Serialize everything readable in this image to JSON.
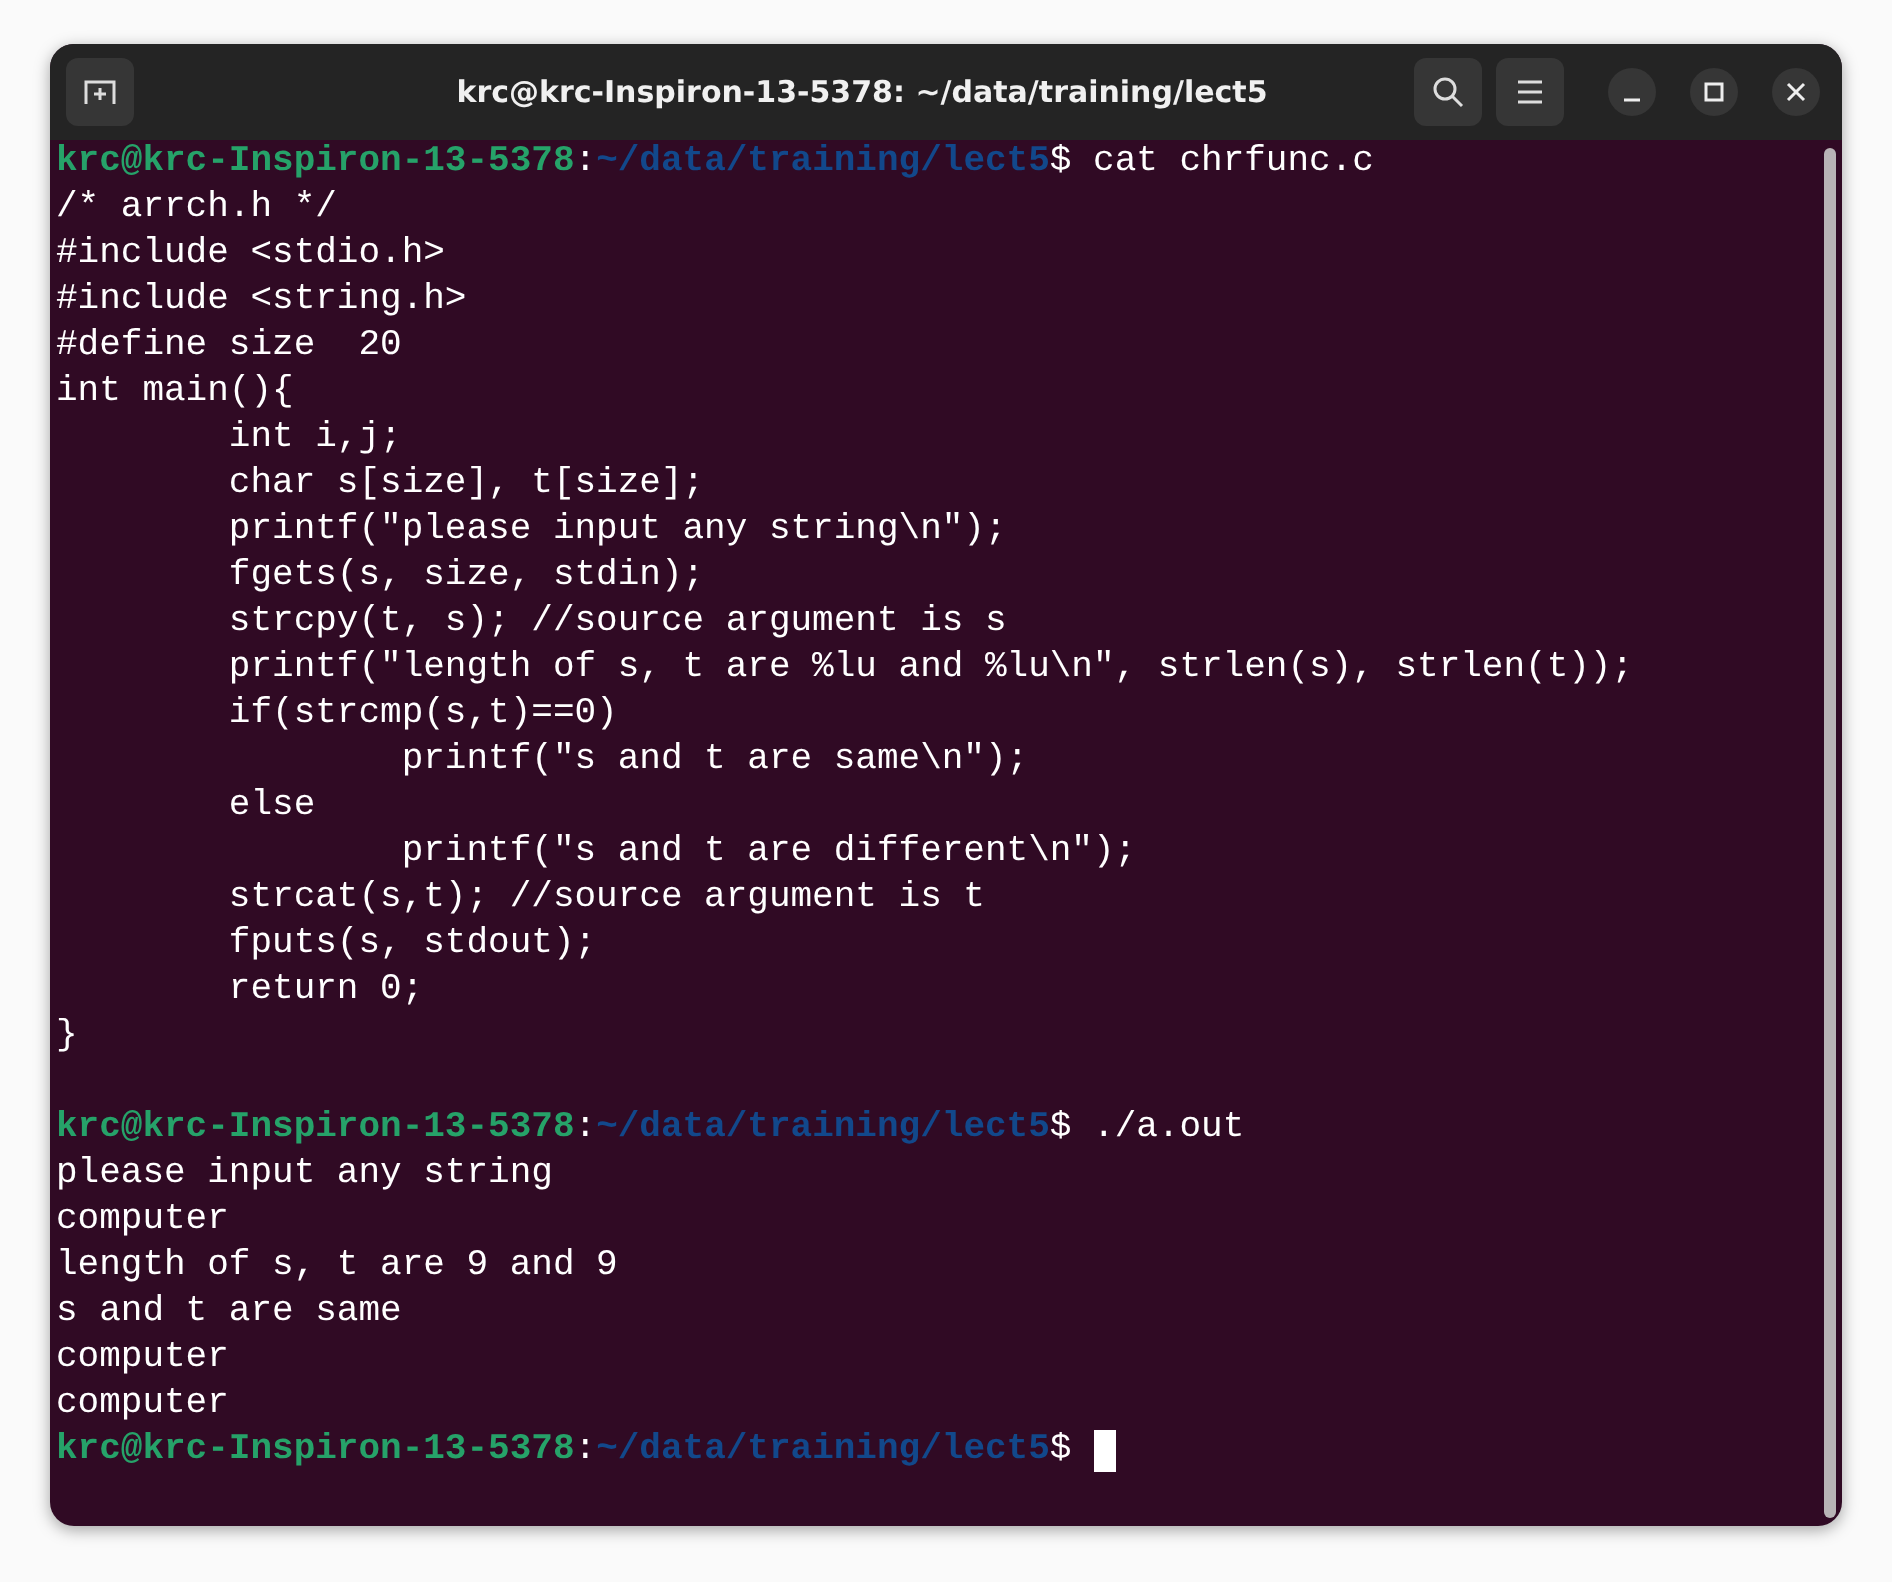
{
  "window": {
    "title": "krc@krc-Inspiron-13-5378: ~/data/training/lect5"
  },
  "terminal": {
    "lines": [
      {
        "kind": "prompt",
        "user_host": "krc@krc-Inspiron-13-5378",
        "colon": ":",
        "path": "~/data/training/lect5",
        "dollar": "$",
        "command": " cat chrfunc.c",
        "cursor": false
      },
      {
        "kind": "output",
        "text": "/* arrch.h */"
      },
      {
        "kind": "output",
        "text": "#include <stdio.h>"
      },
      {
        "kind": "output",
        "text": "#include <string.h>"
      },
      {
        "kind": "output",
        "text": "#define size  20"
      },
      {
        "kind": "output",
        "text": "int main(){"
      },
      {
        "kind": "output",
        "text": "        int i,j;"
      },
      {
        "kind": "output",
        "text": "        char s[size], t[size];"
      },
      {
        "kind": "output",
        "text": "        printf(\"please input any string\\n\");"
      },
      {
        "kind": "output",
        "text": "        fgets(s, size, stdin);"
      },
      {
        "kind": "output",
        "text": "        strcpy(t, s); //source argument is s"
      },
      {
        "kind": "output",
        "text": "        printf(\"length of s, t are %lu and %lu\\n\", strlen(s), strlen(t));"
      },
      {
        "kind": "output",
        "text": "        if(strcmp(s,t)==0)"
      },
      {
        "kind": "output",
        "text": "                printf(\"s and t are same\\n\");"
      },
      {
        "kind": "output",
        "text": "        else"
      },
      {
        "kind": "output",
        "text": "                printf(\"s and t are different\\n\");"
      },
      {
        "kind": "output",
        "text": "        strcat(s,t); //source argument is t"
      },
      {
        "kind": "output",
        "text": "        fputs(s, stdout);"
      },
      {
        "kind": "output",
        "text": "        return 0;"
      },
      {
        "kind": "output",
        "text": "}"
      },
      {
        "kind": "blank"
      },
      {
        "kind": "prompt",
        "user_host": "krc@krc-Inspiron-13-5378",
        "colon": ":",
        "path": "~/data/training/lect5",
        "dollar": "$",
        "command": " ./a.out",
        "cursor": false
      },
      {
        "kind": "output",
        "text": "please input any string"
      },
      {
        "kind": "output",
        "text": "computer"
      },
      {
        "kind": "output",
        "text": "length of s, t are 9 and 9"
      },
      {
        "kind": "output",
        "text": "s and t are same"
      },
      {
        "kind": "output",
        "text": "computer"
      },
      {
        "kind": "output",
        "text": "computer"
      },
      {
        "kind": "prompt",
        "user_host": "krc@krc-Inspiron-13-5378",
        "colon": ":",
        "path": "~/data/training/lect5",
        "dollar": "$",
        "cursor": true
      }
    ]
  }
}
